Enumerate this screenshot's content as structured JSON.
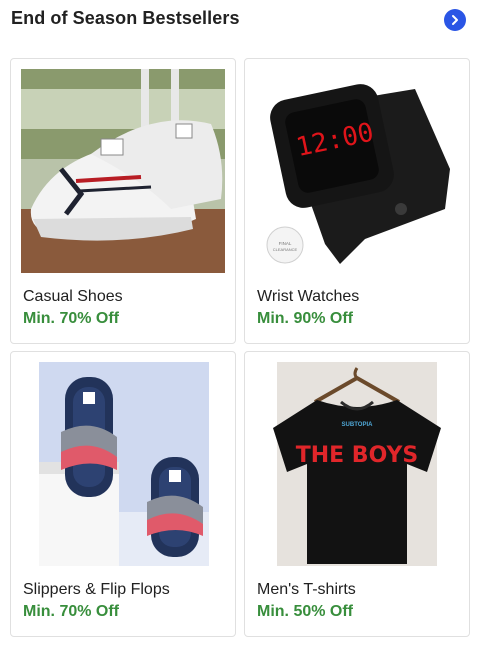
{
  "section": {
    "title": "End of Season Bestsellers",
    "arrow_icon": "chevron-right-icon"
  },
  "products": [
    {
      "name": "Casual Shoes",
      "offer": "Min. 70% Off"
    },
    {
      "name": "Wrist Watches",
      "offer": "Min. 90% Off",
      "image_text": "12:00",
      "badge_text": "FINAL CLEARANCE No Returns"
    },
    {
      "name": "Slippers & Flip Flops",
      "offer": "Min. 70% Off"
    },
    {
      "name": "Men's T-shirts",
      "offer": "Min. 50% Off",
      "image_text": "THE BOYS"
    }
  ],
  "colors": {
    "accent": "#2a55e5",
    "offer_green": "#388e3c"
  }
}
